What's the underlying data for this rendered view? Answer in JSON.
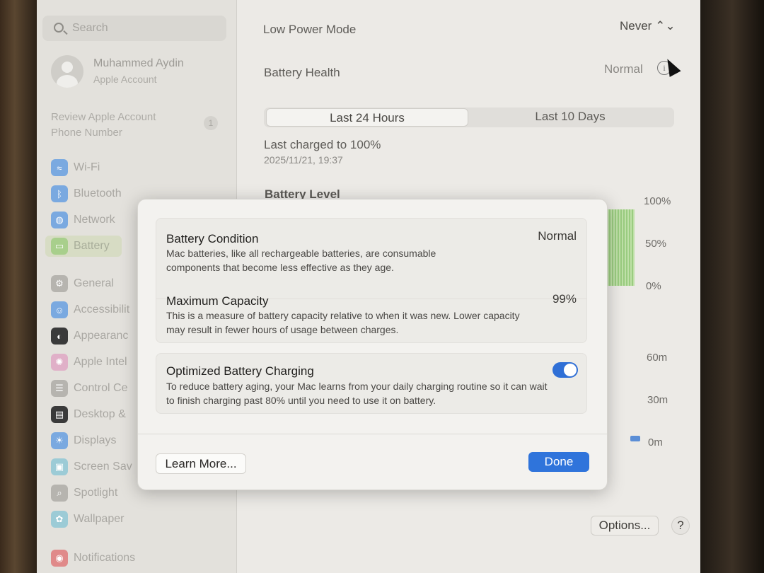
{
  "sidebar": {
    "search_placeholder": "Search",
    "account": {
      "name": "Muhammed Aydin",
      "subtitle": "Apple Account"
    },
    "review": {
      "line1": "Review Apple Account",
      "line2": "Phone Number",
      "badge": "1"
    },
    "items": [
      {
        "label": "Wi-Fi",
        "icon": "wifi-icon",
        "color": "#7aa9e0",
        "glyph": "≈"
      },
      {
        "label": "Bluetooth",
        "icon": "bluetooth-icon",
        "color": "#7aa9e0",
        "glyph": "ᛒ"
      },
      {
        "label": "Network",
        "icon": "globe-icon",
        "color": "#7aa9e0",
        "glyph": "◍"
      },
      {
        "label": "Battery",
        "icon": "battery-icon",
        "color": "#a8cf8c",
        "glyph": "▭"
      },
      {
        "label": "General",
        "icon": "gear-icon",
        "color": "#b6b4af",
        "glyph": "⚙"
      },
      {
        "label": "Accessibilit",
        "icon": "accessibility-icon",
        "color": "#7aa9e0",
        "glyph": "☺"
      },
      {
        "label": "Appearanc",
        "icon": "appearance-icon",
        "color": "#3a3a3a",
        "glyph": "◐"
      },
      {
        "label": "Apple Intel",
        "icon": "apple-intelligence-icon",
        "color": "#e0b0c8",
        "glyph": "✺"
      },
      {
        "label": "Control Ce",
        "icon": "control-center-icon",
        "color": "#b6b4af",
        "glyph": "☰"
      },
      {
        "label": "Desktop &",
        "icon": "desktop-icon",
        "color": "#3a3a3a",
        "glyph": "▤"
      },
      {
        "label": "Displays",
        "icon": "displays-icon",
        "color": "#7aa9e0",
        "glyph": "☀"
      },
      {
        "label": "Screen Sav",
        "icon": "screen-saver-icon",
        "color": "#9ccbd6",
        "glyph": "▣"
      },
      {
        "label": "Spotlight",
        "icon": "spotlight-icon",
        "color": "#b6b4af",
        "glyph": "⌕"
      },
      {
        "label": "Wallpaper",
        "icon": "wallpaper-icon",
        "color": "#9ccbd6",
        "glyph": "✿"
      },
      {
        "label": "Notifications",
        "icon": "notifications-icon",
        "color": "#e08a8a",
        "glyph": "◉"
      }
    ]
  },
  "main": {
    "low_power_mode": {
      "label": "Low Power Mode",
      "value": "Never ⌃⌄"
    },
    "battery_health": {
      "label": "Battery Health",
      "value": "Normal"
    },
    "segment": {
      "tab1": "Last 24 Hours",
      "tab2": "Last 10 Days"
    },
    "last_charged": {
      "title": "Last charged to 100%",
      "date": "2025/11/21, 19:37"
    },
    "battery_level_title": "Battery Level",
    "level_axis": [
      "100%",
      "50%",
      "0%"
    ],
    "usage_axis": [
      "60m",
      "30m",
      "0m"
    ],
    "options_label": "Options...",
    "help_label": "?"
  },
  "dialog": {
    "condition": {
      "title": "Battery Condition",
      "value": "Normal",
      "desc": "Mac batteries, like all rechargeable batteries, are consumable components that become less effective as they age."
    },
    "capacity": {
      "title": "Maximum Capacity",
      "value": "99%",
      "desc": "This is a measure of battery capacity relative to when it was new. Lower capacity may result in fewer hours of usage between charges."
    },
    "optimized": {
      "title": "Optimized Battery Charging",
      "enabled": true,
      "desc": "To reduce battery aging, your Mac learns from your daily charging routine so it can wait to finish charging past 80% until you need to use it on battery."
    },
    "learn_more": "Learn More...",
    "done": "Done"
  }
}
